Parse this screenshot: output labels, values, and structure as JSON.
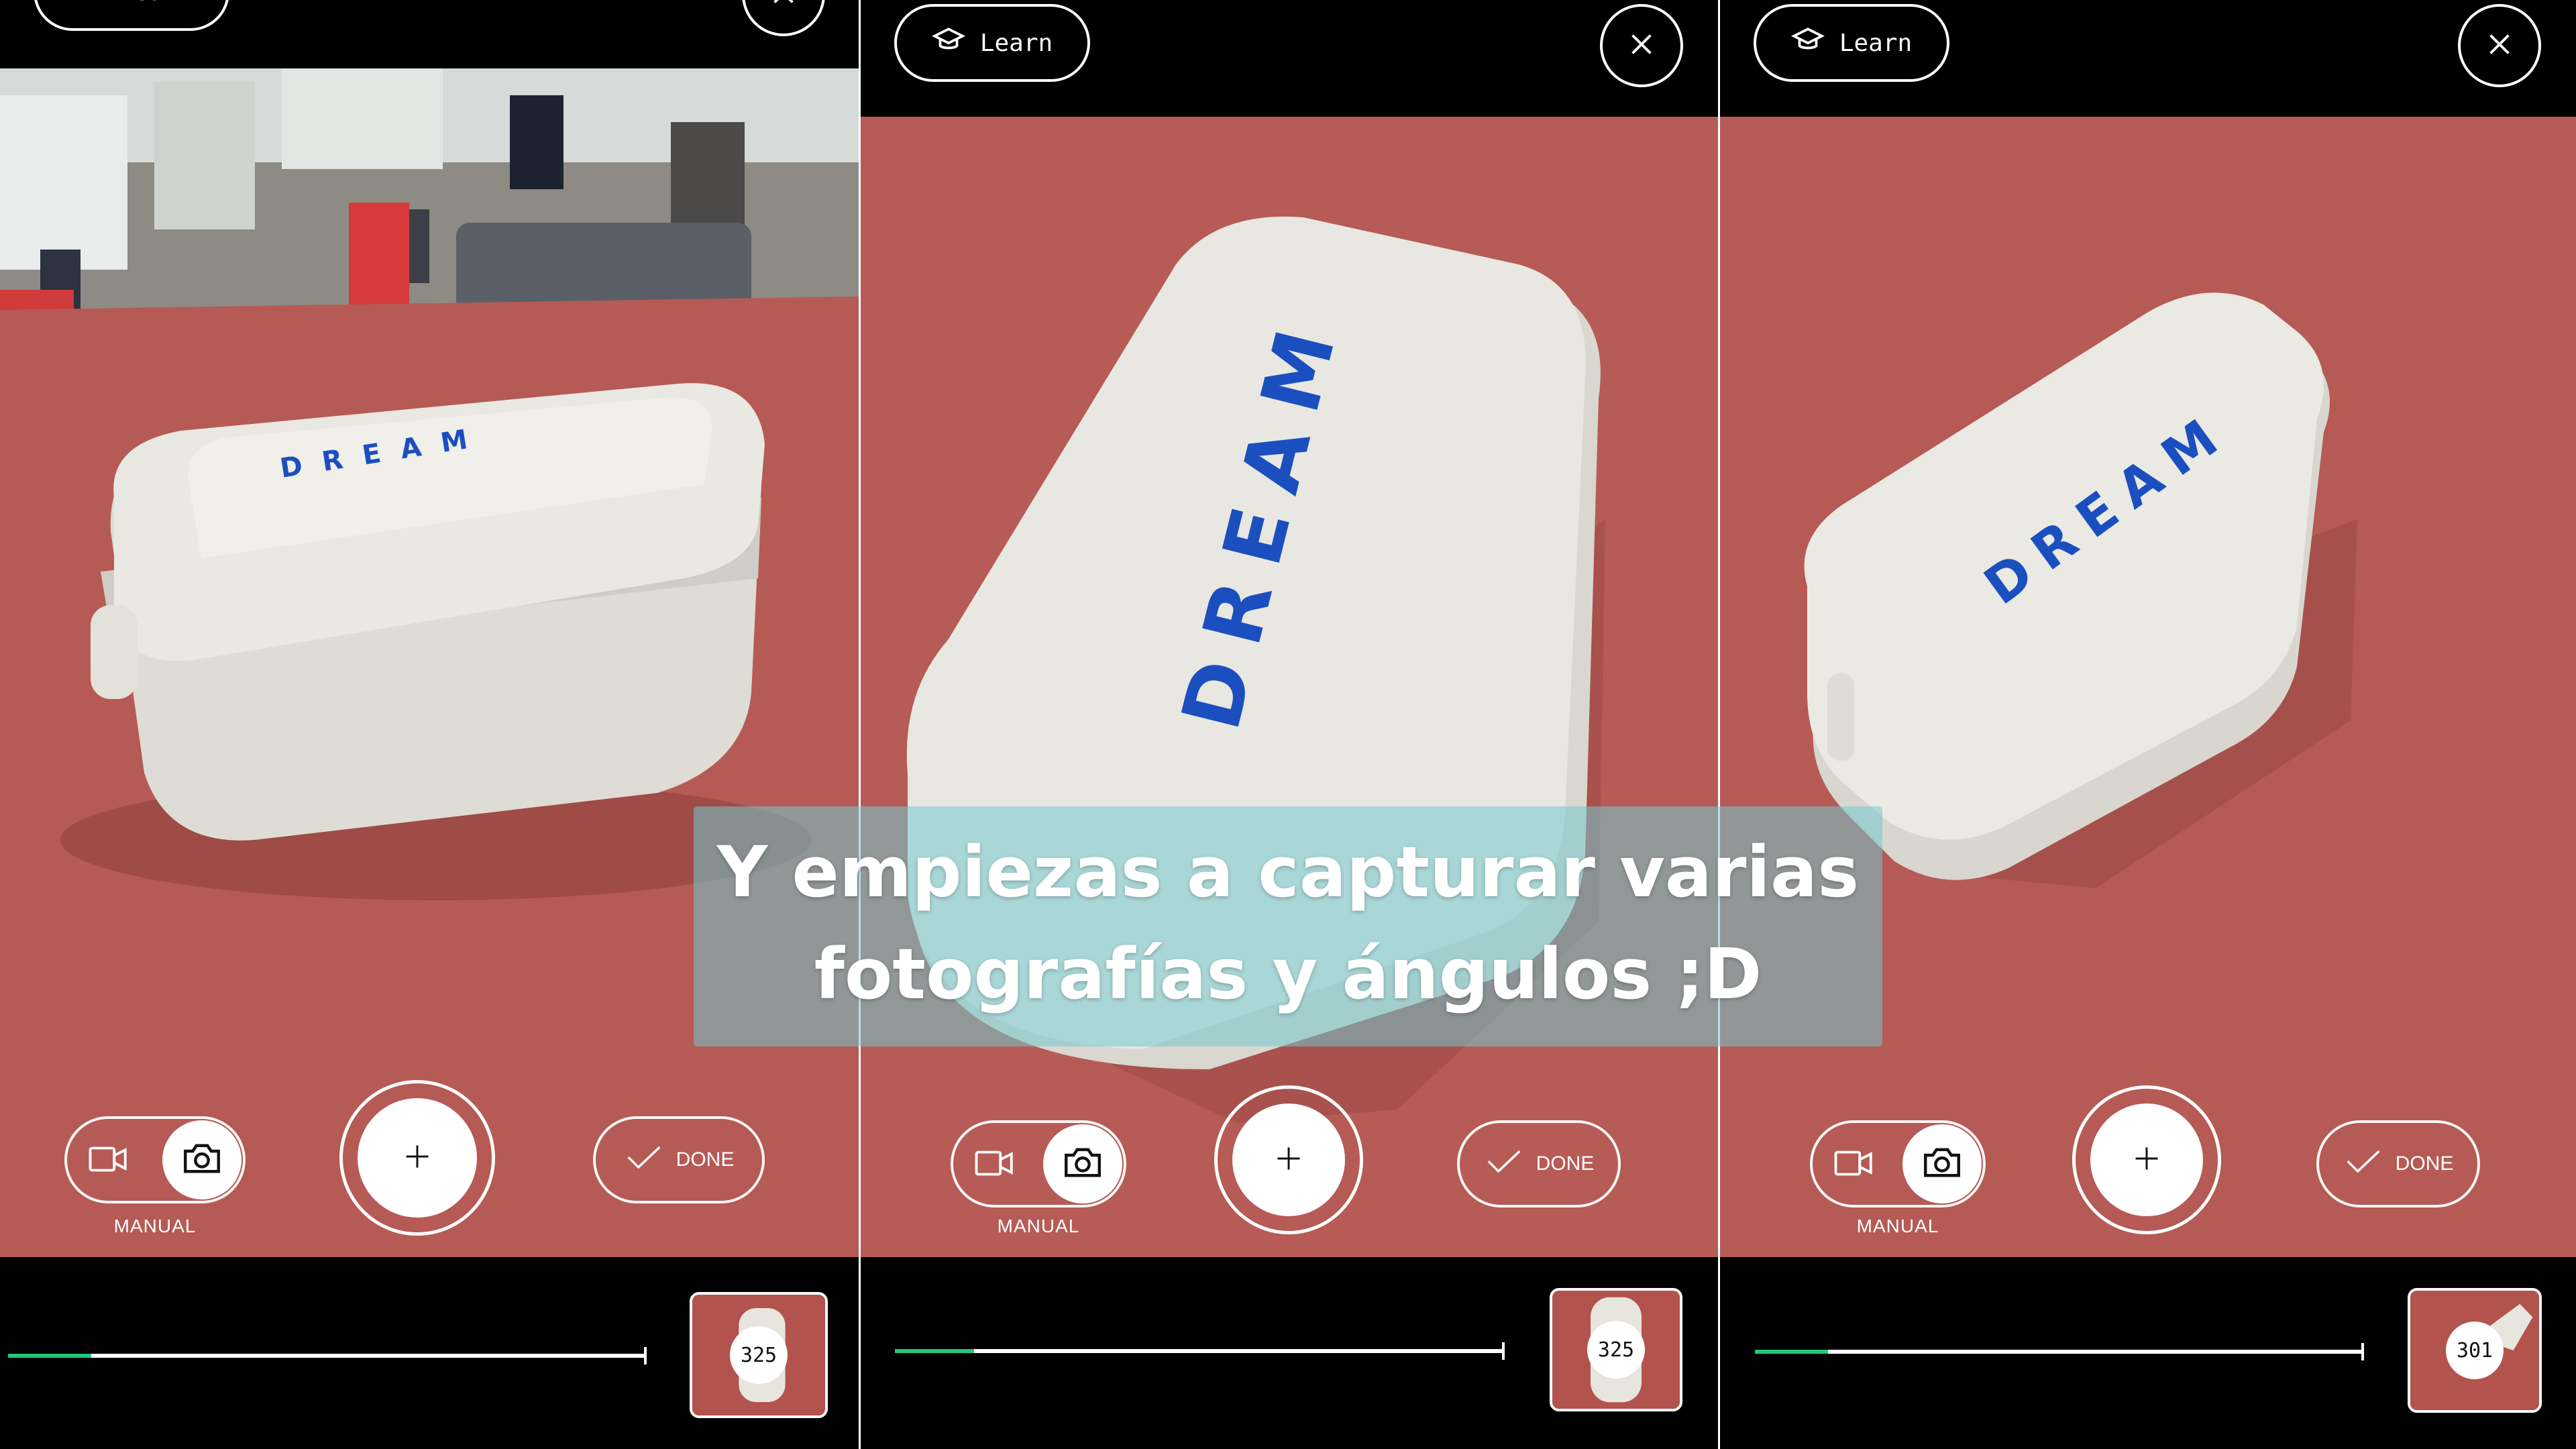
{
  "panels": [
    {
      "id": "panel-1",
      "learn_label": "Learn",
      "mode_label": "MANUAL",
      "done_label": "DONE",
      "capture_count": "325",
      "progress": 0.13,
      "box_text": "DREAM"
    },
    {
      "id": "panel-2",
      "learn_label": "Learn",
      "mode_label": "MANUAL",
      "done_label": "DONE",
      "capture_count": "325",
      "progress": 0.13,
      "box_text": "DREAM"
    },
    {
      "id": "panel-3",
      "learn_label": "Learn",
      "mode_label": "MANUAL",
      "done_label": "DONE",
      "capture_count": "301",
      "progress": 0.12,
      "box_text": "DREAM"
    }
  ],
  "caption": {
    "line1": "Y empiezas a capturar varias",
    "line2": "fotografías y ángulos ;D"
  },
  "icons": {
    "learn": "graduation-cap-icon",
    "close": "close-icon",
    "video_mode": "video-camera-icon",
    "photo_mode": "camera-icon",
    "shutter": "plus-icon",
    "done": "check-icon"
  },
  "colors": {
    "table_red": "#b65a55",
    "progress_green": "#23c77a",
    "caption_bg": "#74c8cd",
    "box_text_blue": "#1b4fc0",
    "box_white": "#e9e8e2"
  }
}
